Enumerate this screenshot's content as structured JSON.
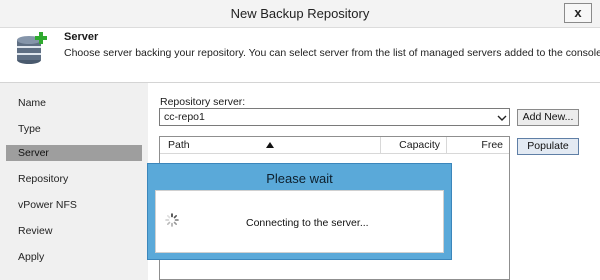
{
  "window": {
    "title": "New Backup Repository",
    "close_label": "x"
  },
  "header": {
    "title": "Server",
    "description": "Choose server backing your repository. You can select server from the list of managed servers added to the console.",
    "icon": "database-add-icon"
  },
  "nav": {
    "items": [
      {
        "label": "Name"
      },
      {
        "label": "Type"
      },
      {
        "label": "Server",
        "active": true
      },
      {
        "label": "Repository"
      },
      {
        "label": "vPower NFS"
      },
      {
        "label": "Review"
      },
      {
        "label": "Apply"
      }
    ]
  },
  "form": {
    "repo_server_label": "Repository server:",
    "repo_server_value": "cc-repo1",
    "add_new_label": "Add New...",
    "populate_label": "Populate",
    "columns": {
      "path": "Path",
      "capacity": "Capacity",
      "free": "Free"
    }
  },
  "wait_dialog": {
    "title": "Please wait",
    "message": "Connecting to the server..."
  },
  "colors": {
    "nav_active": "#9e9e9e",
    "dialog_blue": "#5aa9d9",
    "nav_bg": "#f0f0f0"
  }
}
